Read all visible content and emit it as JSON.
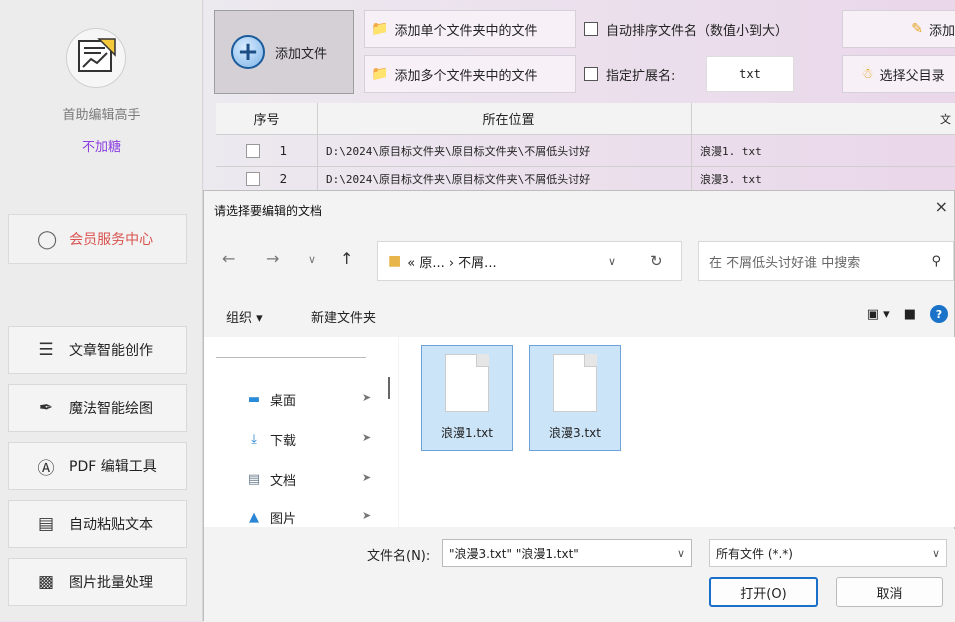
{
  "sidebar": {
    "app_name": "首助编辑高手",
    "app_sub": "不加糖",
    "member_center": "会员服务中心",
    "nav": [
      {
        "label": "文章智能创作",
        "icon": "menu-lines-icon"
      },
      {
        "label": "魔法智能绘图",
        "icon": "brush-icon"
      },
      {
        "label": "PDF 编辑工具",
        "icon": "pdf-circle-icon"
      },
      {
        "label": "自动粘贴文本",
        "icon": "paste-box-icon"
      },
      {
        "label": "图片批量处理",
        "icon": "image-box-icon"
      }
    ]
  },
  "toolbar": {
    "add_file": "添加文件",
    "add_single_folder": "添加单个文件夹中的文件",
    "add_multi_folder": "添加多个文件夹中的文件",
    "auto_sort": "自动排序文件名（数值小到大）",
    "specify_ext": "指定扩展名:",
    "ext_value": "txt",
    "add_right": "添加",
    "select_parent": "选择父目录"
  },
  "table": {
    "headers": [
      "序号",
      "所在位置",
      "文"
    ],
    "rows": [
      {
        "index": "1",
        "path": "D:\\2024\\原目标文件夹\\原目标文件夹\\不屑低头讨好",
        "name": "浪漫1. txt"
      },
      {
        "index": "2",
        "path": "D:\\2024\\原目标文件夹\\原目标文件夹\\不屑低头讨好",
        "name": "浪漫3. txt"
      }
    ]
  },
  "dialog": {
    "title": "请选择要编辑的文档",
    "close": "×",
    "address": "« 原... › 不屑...",
    "search_placeholder": "在 不屑低头讨好谁 中搜索",
    "organize": "组织 ▾",
    "new_folder": "新建文件夹",
    "quick_access": [
      {
        "label": "桌面",
        "icon": "desktop-icon"
      },
      {
        "label": "下载",
        "icon": "download-icon"
      },
      {
        "label": "文档",
        "icon": "documents-icon"
      },
      {
        "label": "图片",
        "icon": "pictures-icon"
      }
    ],
    "files": [
      "浪漫1.txt",
      "浪漫3.txt"
    ],
    "filename_label": "文件名(N):",
    "filename_value": "\"浪漫3.txt\" \"浪漫1.txt\"",
    "filetype": "所有文件 (*.*)",
    "open": "打开(O)",
    "cancel": "取消"
  }
}
